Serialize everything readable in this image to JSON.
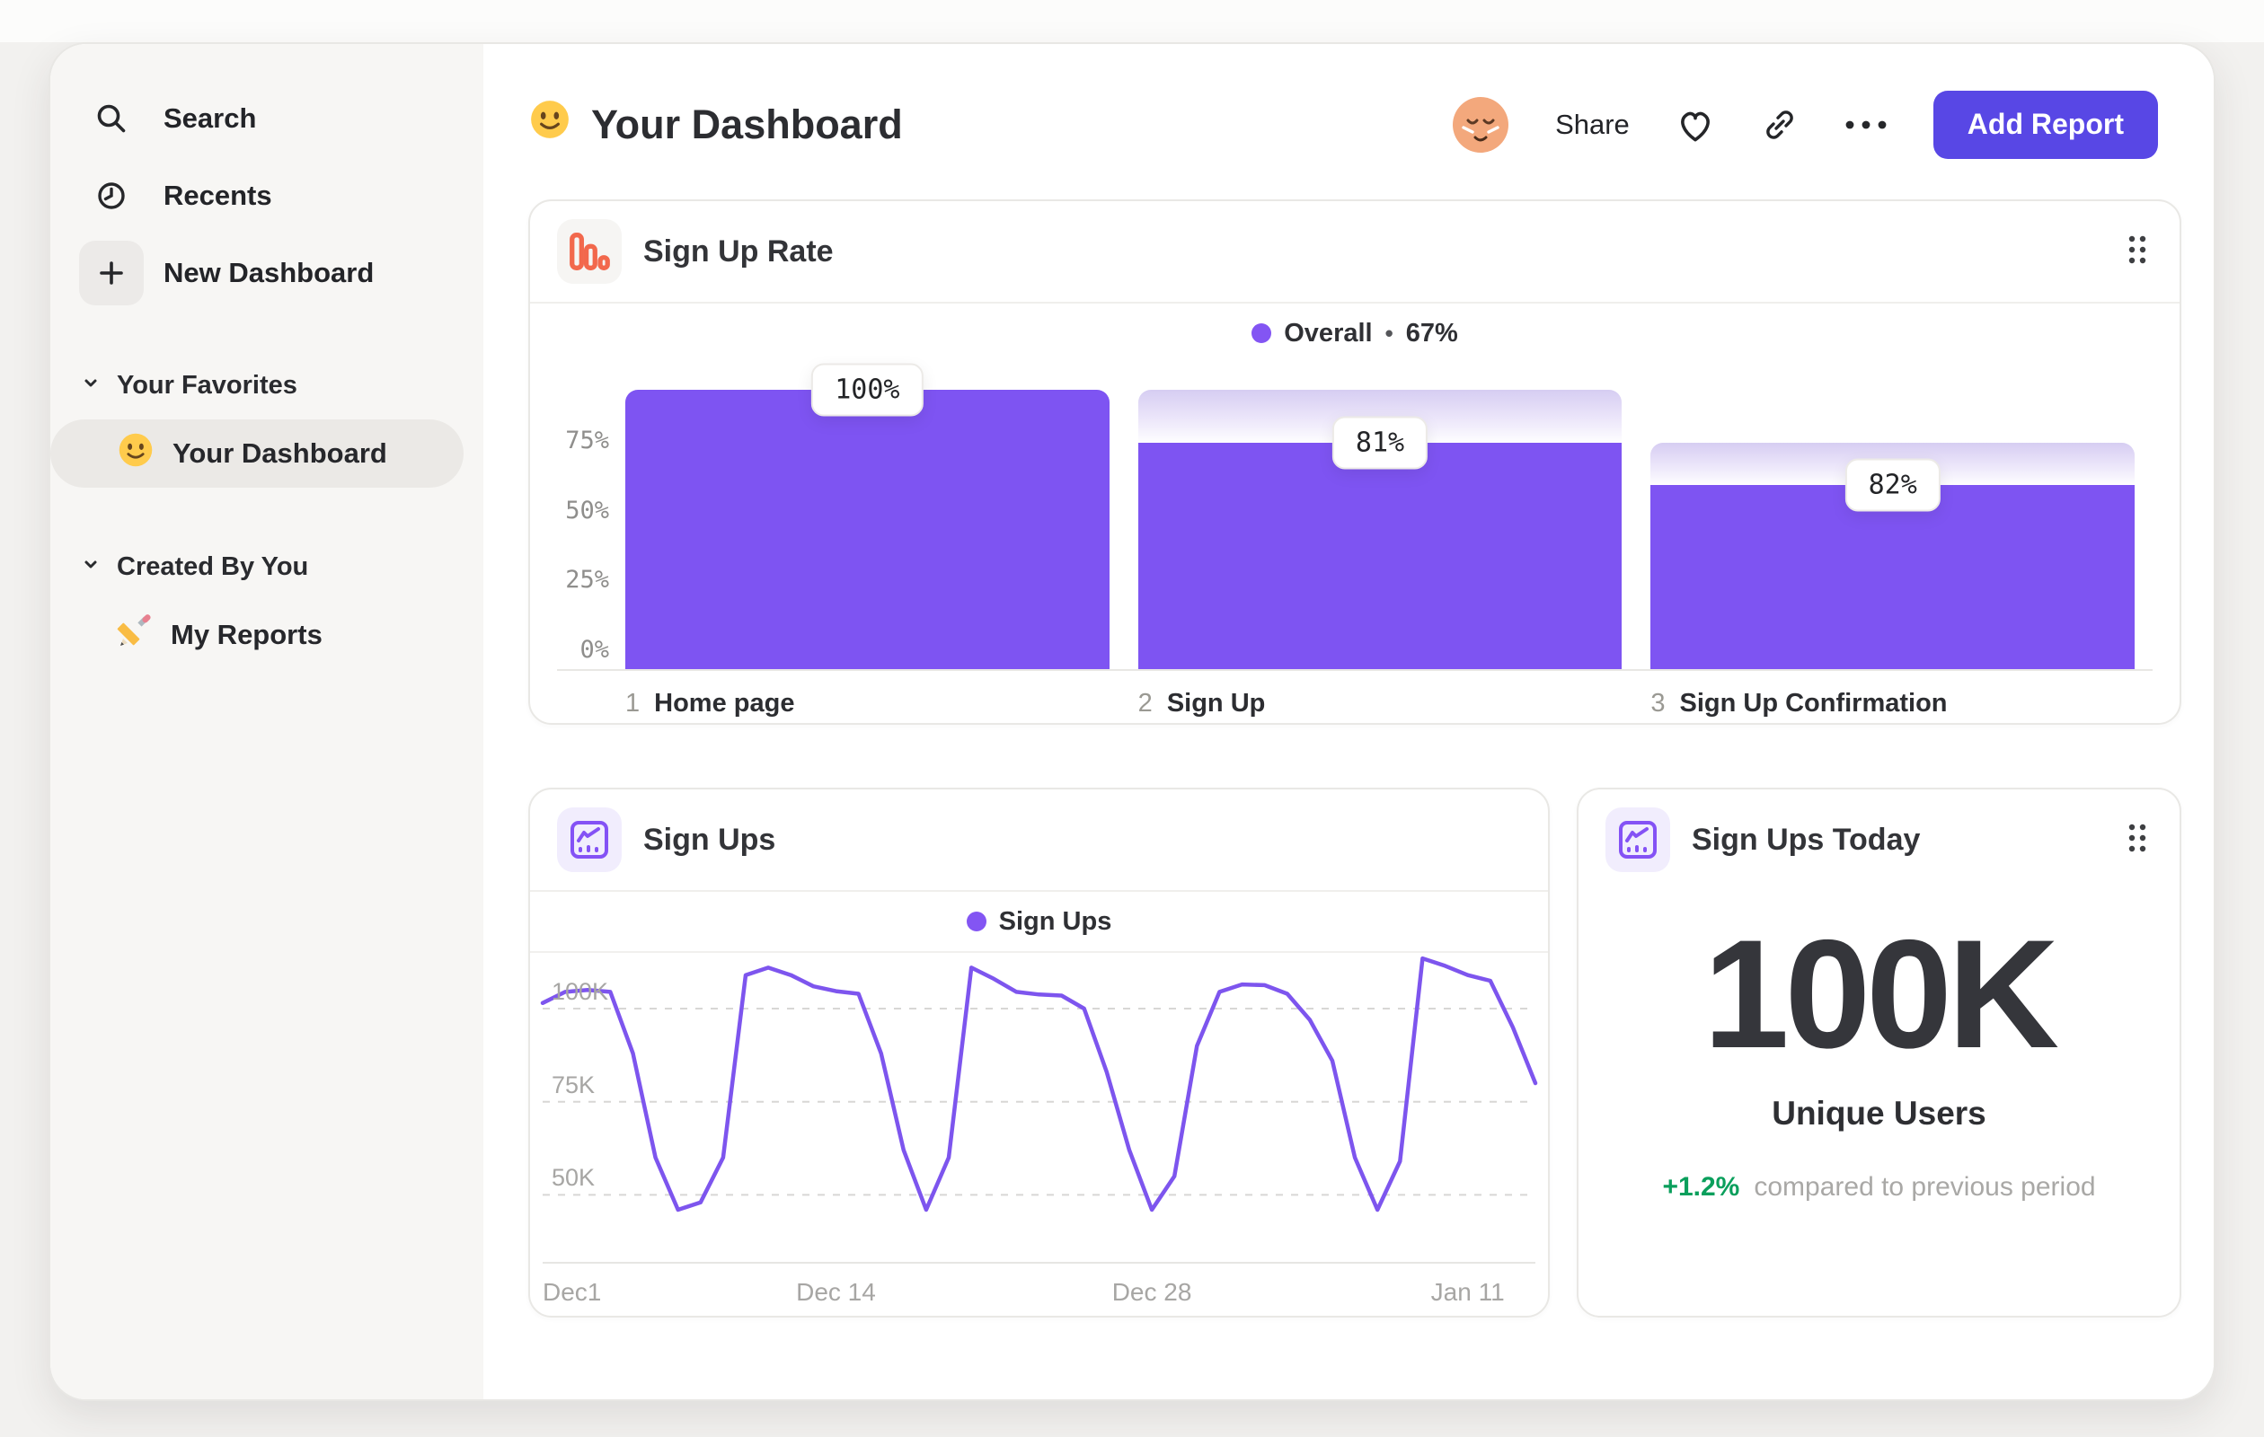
{
  "colors": {
    "accent_purple": "#7e54f2",
    "legend_dot_purple": "#8355f3",
    "ghost_gradient_top": "#d6cdf2",
    "button_indigo": "#5847e5",
    "icon_orange": "#f2684c",
    "icon_purple": "#8452f5",
    "delta_green": "#0a9f5c",
    "sidebar_bg": "#f7f6f4"
  },
  "sidebar": {
    "items": [
      {
        "icon": "search-icon",
        "label": "Search"
      },
      {
        "icon": "recents-clock-icon",
        "label": "Recents"
      },
      {
        "icon": "plus-icon",
        "label": "New Dashboard"
      }
    ],
    "sections": [
      {
        "label": "Your Favorites",
        "items": [
          {
            "icon": "smiley-emoji-icon",
            "label": "Your Dashboard",
            "selected": true
          }
        ]
      },
      {
        "label": "Created By You",
        "items": [
          {
            "icon": "pencil-emoji-icon",
            "label": "My Reports",
            "selected": false
          }
        ]
      }
    ]
  },
  "header": {
    "emoji": "smiley",
    "title": "Your Dashboard",
    "share_label": "Share",
    "add_report_label": "Add Report"
  },
  "chart_data": [
    {
      "type": "bar",
      "subtype": "funnel-steps",
      "title": "Sign Up Rate",
      "legend": {
        "series": "Overall",
        "separator": "•",
        "value": "67%"
      },
      "ylim": [
        0,
        100
      ],
      "yticks": [
        {
          "value": 75,
          "label": "75%"
        },
        {
          "value": 50,
          "label": "50%"
        },
        {
          "value": 25,
          "label": "25%"
        },
        {
          "value": 0,
          "label": "0%"
        }
      ],
      "steps": [
        {
          "number": "1",
          "label": "Home page",
          "badge": "100%",
          "conversion_from_previous_pct": 100,
          "cumulative_pct": 100,
          "ghost_pct": 100
        },
        {
          "number": "2",
          "label": "Sign Up",
          "badge": "81%",
          "conversion_from_previous_pct": 81,
          "cumulative_pct": 81,
          "ghost_pct": 100
        },
        {
          "number": "3",
          "label": "Sign Up Confirmation",
          "badge": "82%",
          "conversion_from_previous_pct": 82,
          "cumulative_pct": 66,
          "ghost_pct": 81
        }
      ]
    },
    {
      "type": "line",
      "title": "Sign Ups",
      "legend": {
        "series": "Sign Ups"
      },
      "unit": "K",
      "ylim": [
        32,
        114
      ],
      "yticks": [
        {
          "value": 100,
          "label": "100K"
        },
        {
          "value": 75,
          "label": "75K"
        },
        {
          "value": 50,
          "label": "50K"
        }
      ],
      "x_ticks": [
        {
          "label": "Dec1",
          "day": 0
        },
        {
          "label": "Dec 14",
          "day": 13
        },
        {
          "label": "Dec 28",
          "day": 27
        },
        {
          "label": "Jan 11",
          "day": 41
        }
      ],
      "x_total_days": 44,
      "values_thousands": [
        101.5,
        104.5,
        105,
        104.5,
        88,
        60,
        46,
        48,
        60,
        109,
        111,
        109,
        106,
        104.7,
        104,
        88,
        62,
        46,
        60,
        111,
        108,
        104.5,
        103.8,
        103.5,
        100,
        83,
        62,
        46,
        55,
        90,
        104.5,
        106.5,
        106.3,
        104,
        97,
        86,
        60,
        46,
        59,
        113.5,
        111.5,
        109,
        107.5,
        95,
        80
      ]
    },
    {
      "type": "metric",
      "title": "Sign Ups Today",
      "value": "100K",
      "value_label": "Unique Users",
      "delta": "+1.2%",
      "delta_context": "compared to previous period"
    }
  ]
}
